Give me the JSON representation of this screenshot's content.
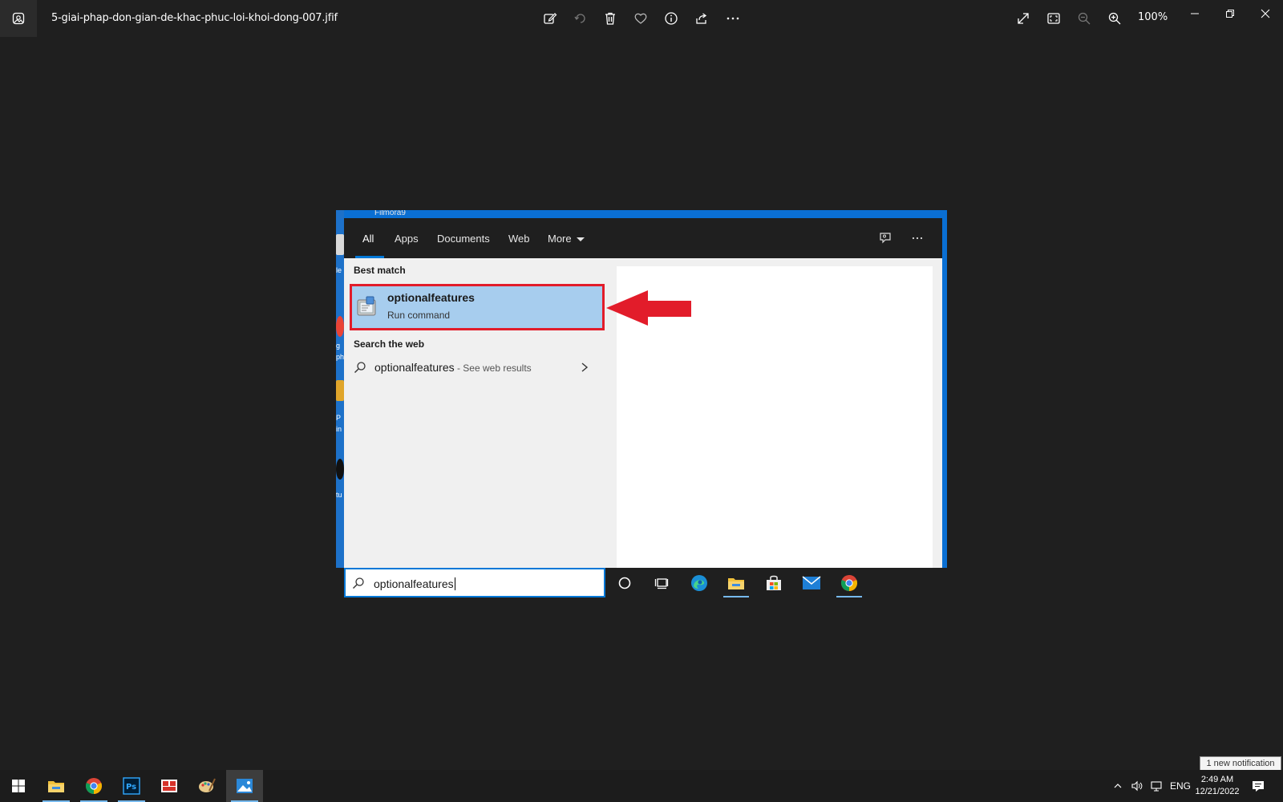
{
  "viewer": {
    "filename": "5-giai-phap-don-gian-de-khac-phuc-loi-khoi-dong-007.jfif",
    "zoom": "100%",
    "toolbar_icons": [
      "edit-icon",
      "rotate-icon",
      "delete-icon",
      "favorite-icon",
      "info-icon",
      "share-icon",
      "more-icon"
    ],
    "right_icons": [
      "fullscreen-icon",
      "fit-icon",
      "zoom-out-icon",
      "zoom-in-icon"
    ]
  },
  "screenshot": {
    "top_label": "Filmora9",
    "desktop_snippets": [
      "le",
      "g",
      "ph",
      "P",
      "in",
      "tu"
    ],
    "tabs": {
      "all": "All",
      "apps": "Apps",
      "documents": "Documents",
      "web": "Web",
      "more": "More"
    },
    "best_match_heading": "Best match",
    "best_match": {
      "title": "optionalfeatures",
      "subtitle": "Run command"
    },
    "search_web_heading": "Search the web",
    "web_result": {
      "term": "optionalfeatures",
      "hint": " - See web results"
    },
    "search_value": "optionalfeatures",
    "annotation_color": "#e21c2a",
    "highlight_color": "#a7cdee"
  },
  "notification_tooltip": "1 new notification",
  "taskbar": {
    "language": "ENG",
    "time": "2:49 AM",
    "date": "12/21/2022"
  }
}
